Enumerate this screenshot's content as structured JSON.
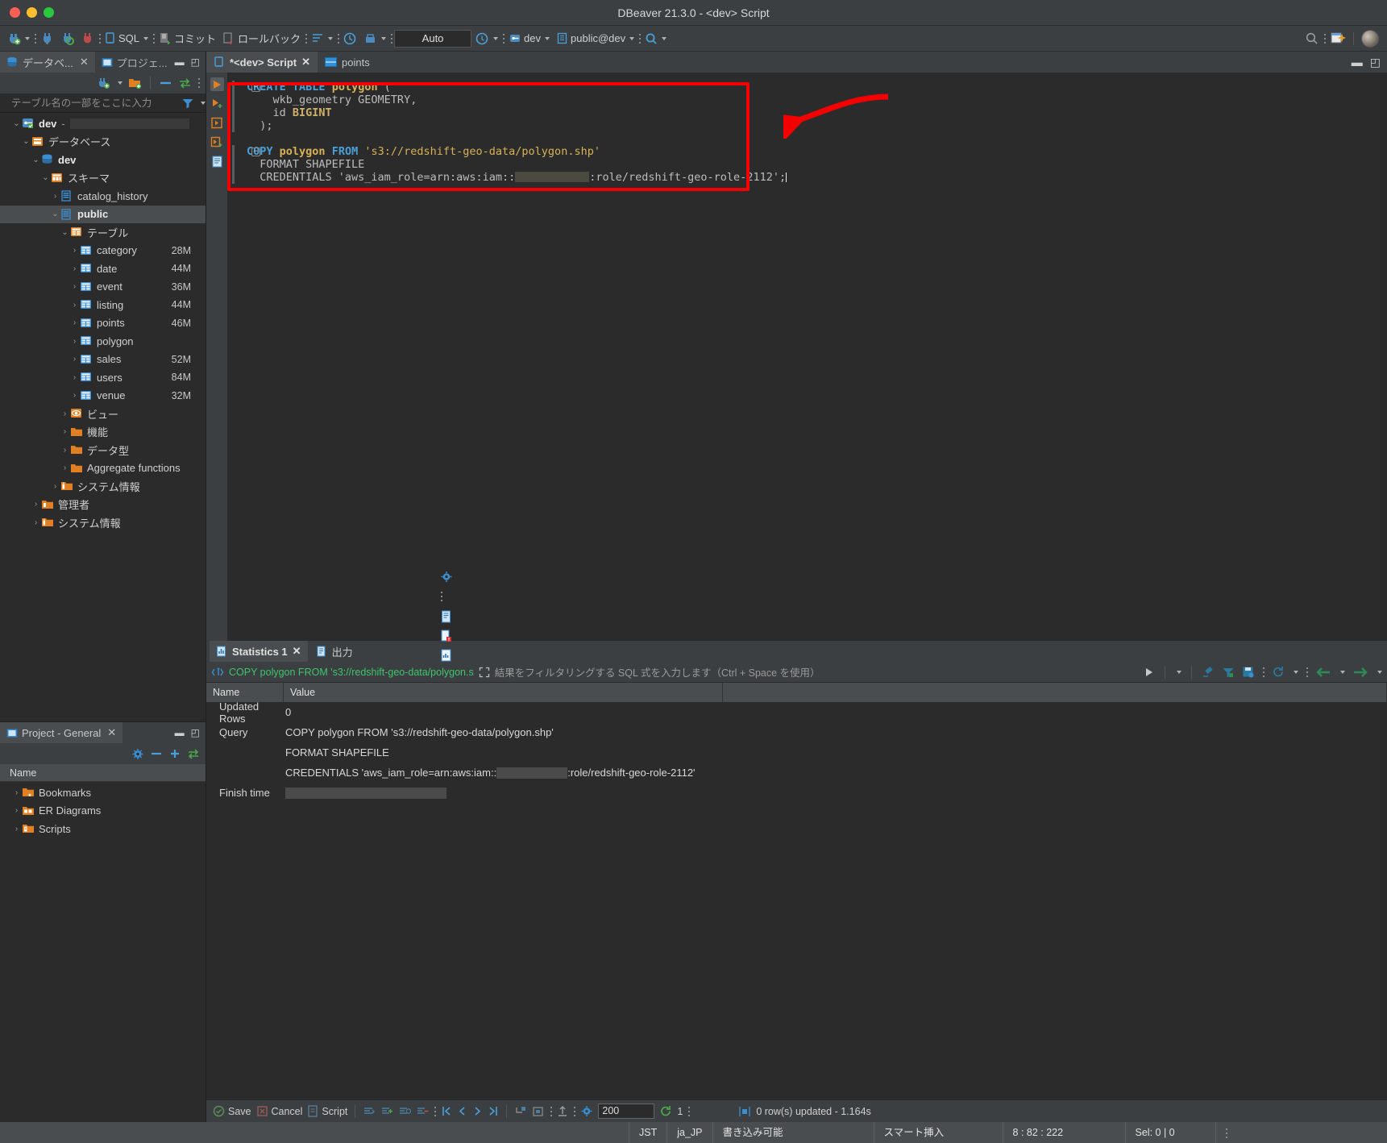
{
  "window": {
    "title": "DBeaver 21.3.0 - <dev> Script",
    "controls": [
      "close",
      "minimize",
      "maximize"
    ]
  },
  "toolbar": {
    "items": [
      {
        "name": "new-connection",
        "icon": "plug-plus-icon",
        "label": ""
      },
      {
        "name": "connect",
        "icon": "plug-icon",
        "label": ""
      },
      {
        "name": "refresh-connection",
        "icon": "plug-refresh-icon",
        "label": ""
      },
      {
        "name": "disconnect",
        "icon": "plug-disconnect-icon",
        "label": ""
      },
      {
        "name": "sql-editor",
        "icon": "sql-icon",
        "label": "SQL"
      },
      {
        "name": "commit",
        "icon": "commit-icon",
        "label": "コミット"
      },
      {
        "name": "rollback",
        "icon": "rollback-icon",
        "label": "ロールバック"
      },
      {
        "name": "transaction-mode",
        "icon": "transaction-icon",
        "label": ""
      },
      {
        "name": "transaction-log",
        "icon": "clock-icon",
        "label": ""
      },
      {
        "name": "database-tasks",
        "icon": "tasks-icon",
        "label": ""
      }
    ],
    "auto_commit_value": "Auto",
    "connection_selector": "dev",
    "schema_selector": "public@dev",
    "search_icon": "search-icon",
    "right_icons": [
      "search-icon",
      "overflow-icon",
      "new-window-icon",
      "avatar"
    ]
  },
  "left_panel": {
    "tabs": [
      {
        "label": "データベ...",
        "icon": "database-navigator-icon",
        "active": true,
        "closable": true
      },
      {
        "label": "プロジェ...",
        "icon": "project-explorer-icon",
        "active": false,
        "closable": false
      }
    ],
    "window_buttons": [
      "minimize",
      "maximize"
    ],
    "toolbar_icons": [
      "new-connection-icon",
      "new-folder-icon",
      "collapse-all-icon",
      "link-editor-icon",
      "view-menu-icon"
    ],
    "filter_placeholder": "テーブル名の一部をここに入力",
    "filter_value": "",
    "filter_icon": "funnel-icon",
    "tree": [
      {
        "label": "dev",
        "depth": 0,
        "icon": "connection-icon",
        "expanded": true,
        "bold": true,
        "size": "",
        "suffix": "-",
        "redacted": true
      },
      {
        "label": "データベース",
        "depth": 1,
        "icon": "databases-folder-icon",
        "expanded": true,
        "size": ""
      },
      {
        "label": "dev",
        "depth": 2,
        "icon": "database-icon",
        "expanded": true,
        "bold": true,
        "size": ""
      },
      {
        "label": "スキーマ",
        "depth": 3,
        "icon": "schemas-folder-icon",
        "expanded": true,
        "size": ""
      },
      {
        "label": "catalog_history",
        "depth": 4,
        "icon": "schema-icon",
        "expanded": false,
        "size": ""
      },
      {
        "label": "public",
        "depth": 4,
        "icon": "schema-icon",
        "expanded": true,
        "bold": true,
        "selected": true,
        "size": ""
      },
      {
        "label": "テーブル",
        "depth": 5,
        "icon": "tables-folder-icon",
        "expanded": true,
        "size": ""
      },
      {
        "label": "category",
        "depth": 6,
        "icon": "table-icon",
        "expanded": false,
        "size": "28M"
      },
      {
        "label": "date",
        "depth": 6,
        "icon": "table-icon",
        "expanded": false,
        "size": "44M"
      },
      {
        "label": "event",
        "depth": 6,
        "icon": "table-icon",
        "expanded": false,
        "size": "36M"
      },
      {
        "label": "listing",
        "depth": 6,
        "icon": "table-icon",
        "expanded": false,
        "size": "44M"
      },
      {
        "label": "points",
        "depth": 6,
        "icon": "table-icon",
        "expanded": false,
        "size": "46M"
      },
      {
        "label": "polygon",
        "depth": 6,
        "icon": "table-icon",
        "expanded": false,
        "size": ""
      },
      {
        "label": "sales",
        "depth": 6,
        "icon": "table-icon",
        "expanded": false,
        "size": "52M"
      },
      {
        "label": "users",
        "depth": 6,
        "icon": "table-icon",
        "expanded": false,
        "size": "84M"
      },
      {
        "label": "venue",
        "depth": 6,
        "icon": "table-icon",
        "expanded": false,
        "size": "32M"
      },
      {
        "label": "ビュー",
        "depth": 5,
        "icon": "views-folder-icon",
        "expanded": false,
        "size": ""
      },
      {
        "label": "機能",
        "depth": 5,
        "icon": "functions-folder-icon",
        "expanded": false,
        "size": ""
      },
      {
        "label": "データ型",
        "depth": 5,
        "icon": "datatypes-folder-icon",
        "expanded": false,
        "size": ""
      },
      {
        "label": "Aggregate functions",
        "depth": 5,
        "icon": "aggregate-folder-icon",
        "expanded": false,
        "size": ""
      },
      {
        "label": "システム情報",
        "depth": 4,
        "icon": "system-info-icon",
        "expanded": false,
        "size": ""
      },
      {
        "label": "管理者",
        "depth": 2,
        "icon": "admin-folder-icon",
        "expanded": false,
        "size": ""
      },
      {
        "label": "システム情報",
        "depth": 2,
        "icon": "system-info-icon",
        "expanded": false,
        "size": ""
      }
    ]
  },
  "project_panel": {
    "tab_label": "Project - General",
    "tab_icon": "project-icon",
    "window_buttons": [
      "minimize",
      "maximize"
    ],
    "toolbar_icons": [
      "gear-icon",
      "collapse-icon",
      "add-icon",
      "link-icon"
    ],
    "column_header": "Name",
    "items": [
      {
        "label": "Bookmarks",
        "icon": "bookmarks-folder-icon"
      },
      {
        "label": "ER Diagrams",
        "icon": "er-diagram-folder-icon"
      },
      {
        "label": "Scripts",
        "icon": "scripts-folder-icon"
      }
    ]
  },
  "editor": {
    "tabs": [
      {
        "label": "*<dev> Script",
        "icon": "sql-script-icon",
        "active": true,
        "closable": true
      },
      {
        "label": "points",
        "icon": "table-icon",
        "active": false,
        "closable": false
      }
    ],
    "window_buttons": [
      "minimize",
      "maximize"
    ],
    "gutter_icons": [
      "execute-statement-icon",
      "execute-script-icon",
      "execute-to-new-tab-icon",
      "execute-expression-icon",
      "generate-sql-icon"
    ],
    "side_icons": [
      "settings-icon",
      "output-log-icon",
      "error-log-icon",
      "statistics-icon"
    ],
    "sql_lines": [
      {
        "fold": true,
        "tokens": [
          {
            "t": "CREATE",
            "c": "kw"
          },
          {
            "t": " ",
            "c": "plain"
          },
          {
            "t": "TABLE",
            "c": "kw"
          },
          {
            "t": " ",
            "c": "plain"
          },
          {
            "t": "polygon",
            "c": "tbl"
          },
          {
            "t": " (",
            "c": "plain"
          }
        ]
      },
      {
        "fold": false,
        "tokens": [
          {
            "t": "    wkb_geometry GEOMETRY,",
            "c": "plain"
          }
        ]
      },
      {
        "fold": false,
        "tokens": [
          {
            "t": "    id ",
            "c": "plain"
          },
          {
            "t": "BIGINT",
            "c": "kw2"
          }
        ]
      },
      {
        "fold": false,
        "tokens": [
          {
            "t": "  );",
            "c": "plain"
          }
        ]
      },
      {
        "fold": false,
        "tokens": [
          {
            "t": "",
            "c": "plain"
          }
        ]
      },
      {
        "fold": true,
        "tokens": [
          {
            "t": "COPY",
            "c": "kw"
          },
          {
            "t": " ",
            "c": "plain"
          },
          {
            "t": "polygon",
            "c": "tbl"
          },
          {
            "t": " ",
            "c": "plain"
          },
          {
            "t": "FROM",
            "c": "kw"
          },
          {
            "t": " ",
            "c": "plain"
          },
          {
            "t": "'s3://redshift-geo-data/polygon.shp'",
            "c": "str"
          }
        ]
      },
      {
        "fold": false,
        "tokens": [
          {
            "t": "  FORMAT SHAPEFILE",
            "c": "plain"
          }
        ]
      },
      {
        "fold": false,
        "tokens": [
          {
            "t": "  CREDENTIALS 'aws_iam_role=arn:aws:iam::",
            "c": "plain"
          },
          {
            "t": "[REDACTED]",
            "c": "redacted"
          },
          {
            "t": ":role/redshift-geo-role-2112';",
            "c": "plain"
          }
        ]
      }
    ],
    "annotation": {
      "type": "red-box-with-arrow",
      "color": "#f40000"
    }
  },
  "results": {
    "tabs": [
      {
        "label": "Statistics 1",
        "icon": "statistics-icon",
        "active": true,
        "closable": true
      },
      {
        "label": "出力",
        "icon": "output-icon",
        "active": false,
        "closable": false
      }
    ],
    "filter": {
      "query_text": "COPY polygon FROM 's3://redshift-geo-data/polygon.s",
      "placeholder": "結果をフィルタリングする SQL 式を入力します（Ctrl + Space を使用）",
      "left_icon": "sql-filter-icon",
      "expand_icon": "expand-icon",
      "right_icons": [
        "execute-icon",
        "dropdown-icon",
        "clear-filter-icon",
        "apply-filter-icon",
        "save-filter-icon",
        "refresh-icon",
        "back-icon",
        "forward-icon"
      ]
    },
    "columns": [
      "Name",
      "Value"
    ],
    "rows": [
      {
        "name": "Updated Rows",
        "value": "0"
      },
      {
        "name": "Query",
        "value": "COPY polygon FROM 's3://redshift-geo-data/polygon.shp'"
      },
      {
        "name": "",
        "value": "FORMAT SHAPEFILE"
      },
      {
        "name": "",
        "value": "CREDENTIALS 'aws_iam_role=arn:aws:iam::[REDACTED]:role/redshift-geo-role-2112'"
      },
      {
        "name": "Finish time",
        "value": "[REDACTED]"
      }
    ],
    "bottom_toolbar": {
      "save_label": "Save",
      "cancel_label": "Cancel",
      "script_label": "Script",
      "fetch_size": "200",
      "refresh_count": "1",
      "status_text": "0 row(s) updated - 1.164s",
      "nav_icons": [
        "first-row-icon",
        "prev-row-icon",
        "next-row-icon",
        "last-row-icon"
      ],
      "edit_icons": [
        "edit-row-icon",
        "add-row-icon",
        "duplicate-row-icon",
        "delete-row-icon"
      ],
      "extra_icons": [
        "calc-icon",
        "panels-icon",
        "export-icon",
        "config-icon"
      ]
    }
  },
  "statusbar": {
    "timezone": "JST",
    "locale": "ja_JP",
    "writable": "書き込み可能",
    "insert_mode": "スマート挿入",
    "position": "8 : 82 : 222",
    "selection": "Sel: 0 | 0",
    "overflow_icon": "overflow-icon"
  },
  "colors": {
    "accent_orange": "#e08022",
    "accent_blue": "#3b8ed0",
    "annotation_red": "#f40000",
    "filter_green": "#3ec46d",
    "keyword_blue": "#4a9fd8",
    "string_gold": "#d8b257",
    "bg_dark": "#2b2b2b",
    "bg_panel": "#3c3f41"
  }
}
